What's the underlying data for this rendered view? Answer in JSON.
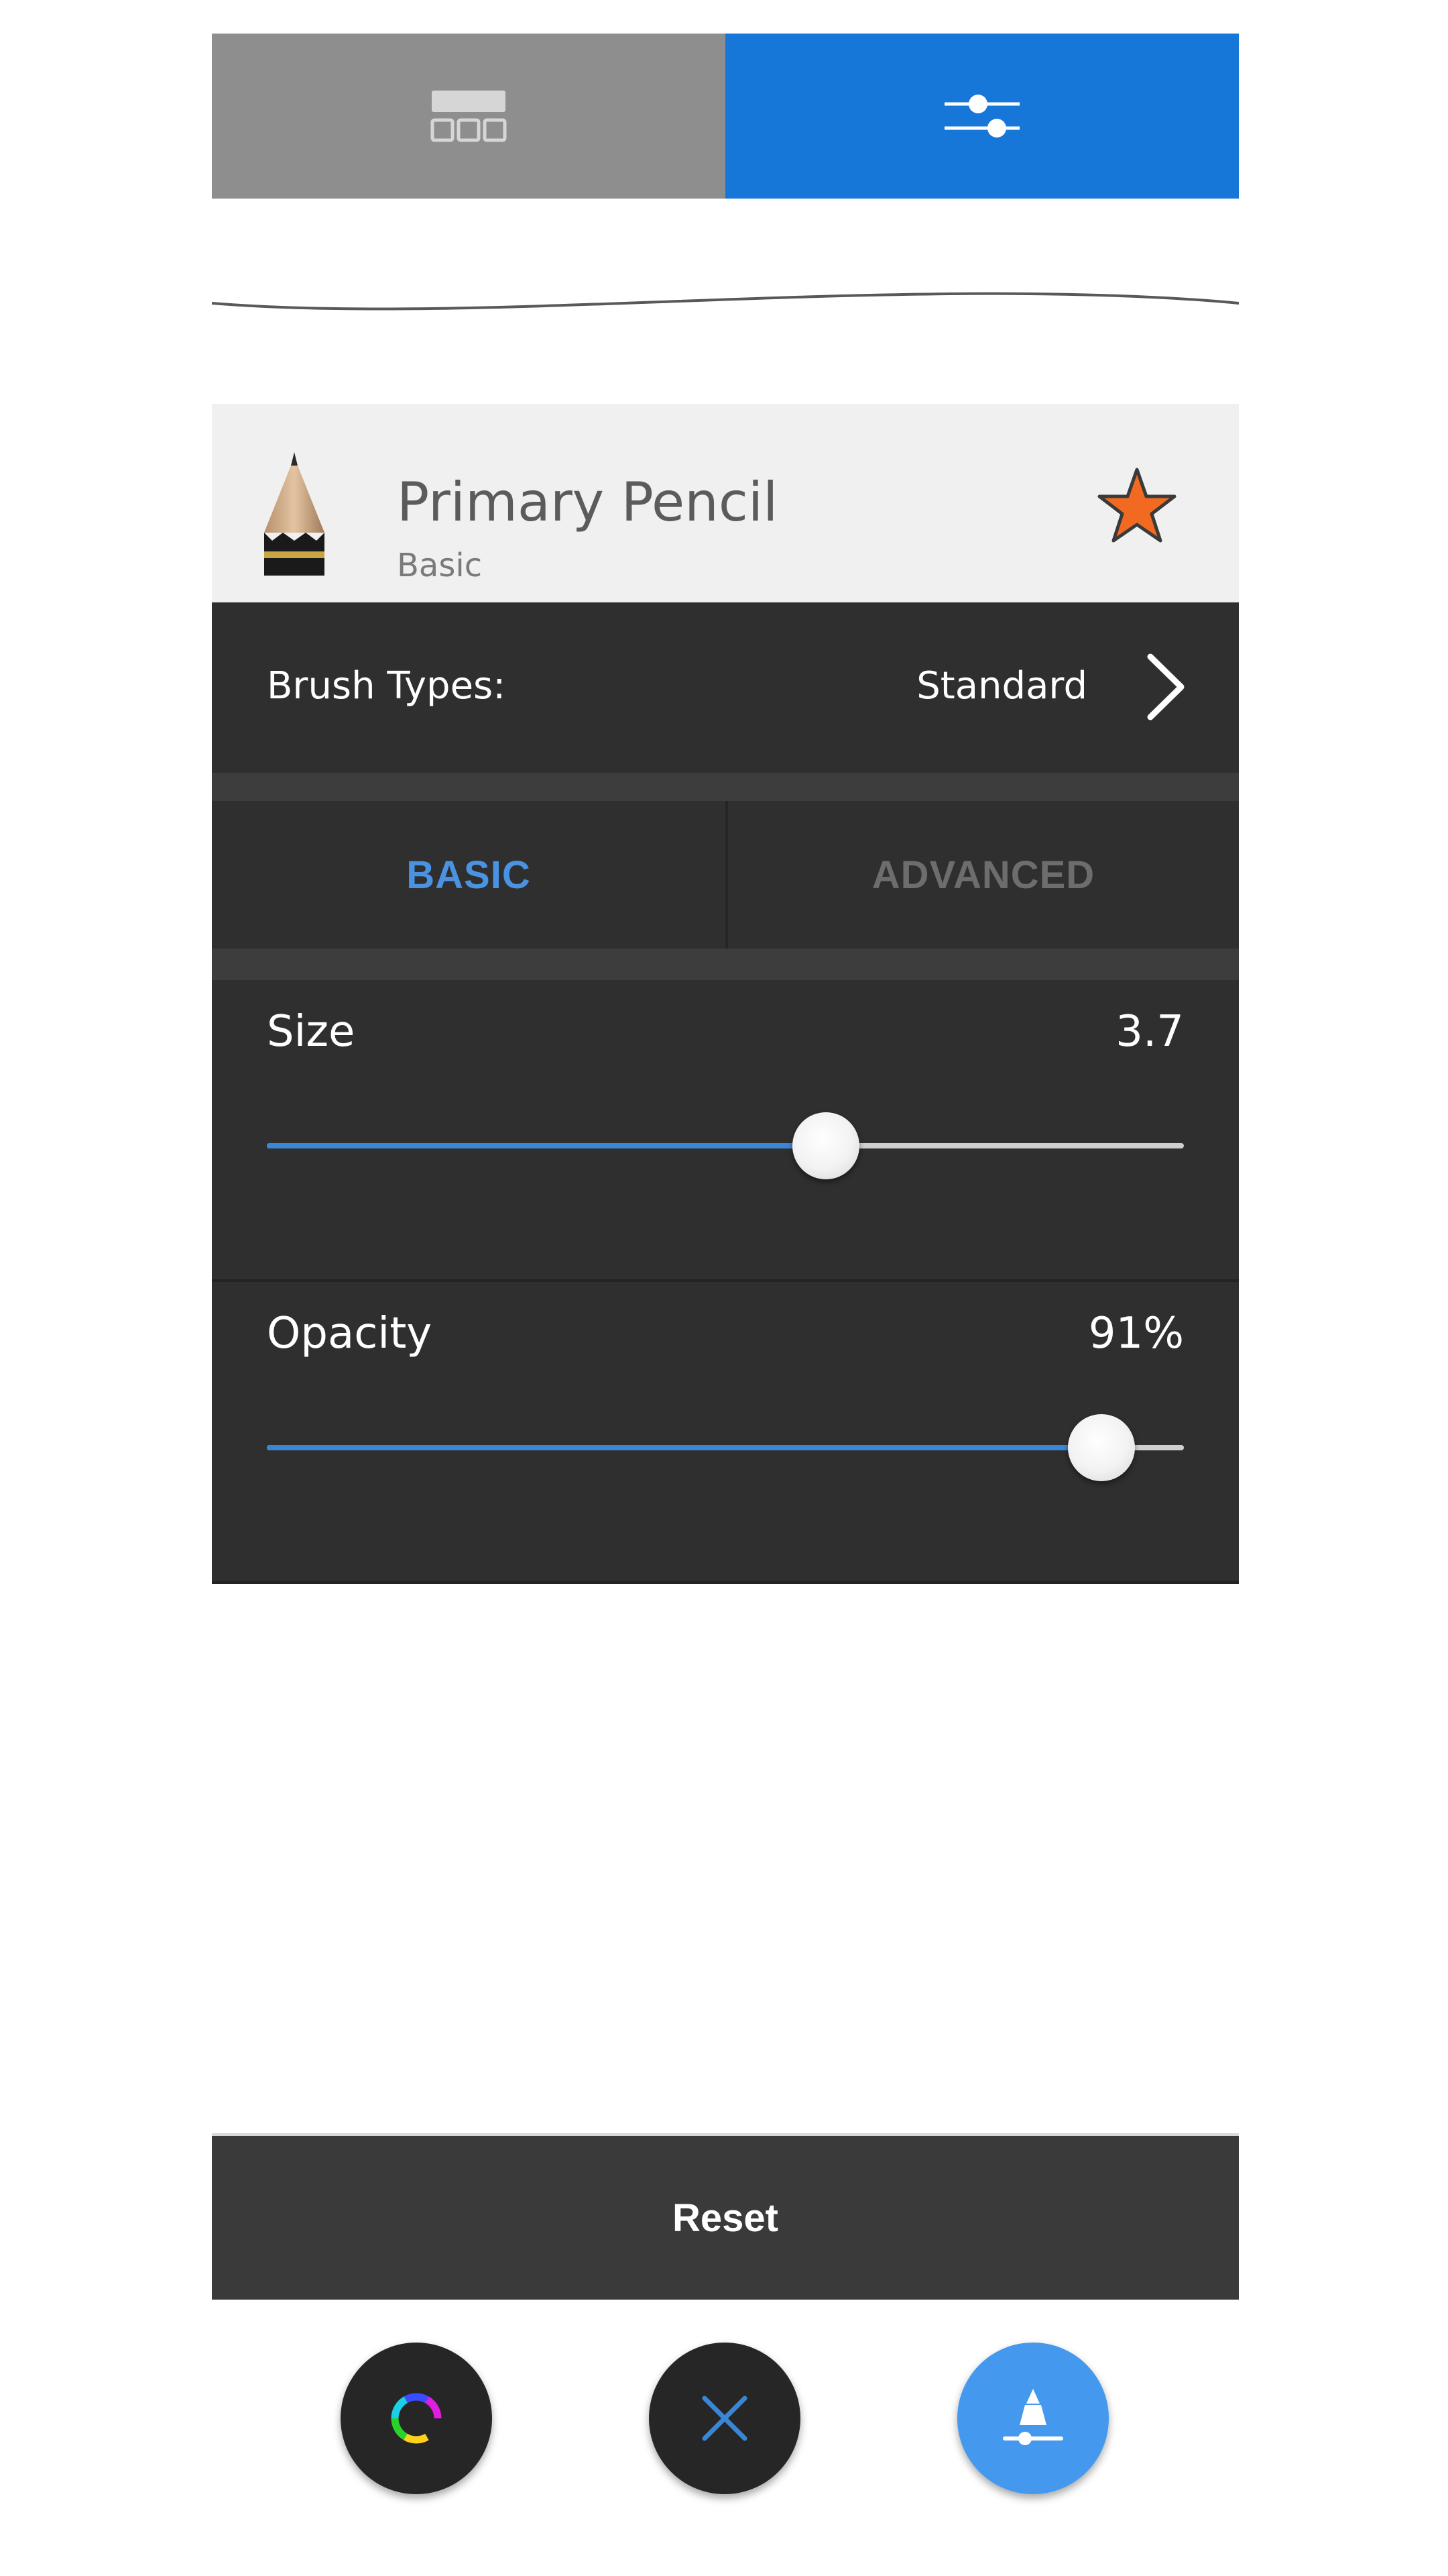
{
  "top_tabs": {
    "library": {
      "icon": "brush-library-grid-icon",
      "color": "#8e8e8e"
    },
    "settings": {
      "icon": "sliders-icon",
      "color": "#1677d9",
      "selected": true
    }
  },
  "brush": {
    "name": "Primary Pencil",
    "category": "Basic",
    "favorite": true
  },
  "brush_types": {
    "label": "Brush Types:",
    "value": "Standard"
  },
  "mode_tabs": {
    "basic": "BASIC",
    "advanced": "ADVANCED",
    "active": "basic",
    "active_color": "#4a93e3"
  },
  "sliders": {
    "size": {
      "label": "Size",
      "value": "3.7",
      "fraction": 0.61
    },
    "opacity": {
      "label": "Opacity",
      "value": "91%",
      "fraction": 0.91
    }
  },
  "reset": {
    "label": "Reset"
  },
  "fabs": {
    "color": {
      "icon": "color-wheel-icon"
    },
    "close": {
      "icon": "close-icon",
      "color": "#3a86d6"
    },
    "brush": {
      "icon": "brush-settings-icon",
      "color": "#4499ee"
    }
  }
}
